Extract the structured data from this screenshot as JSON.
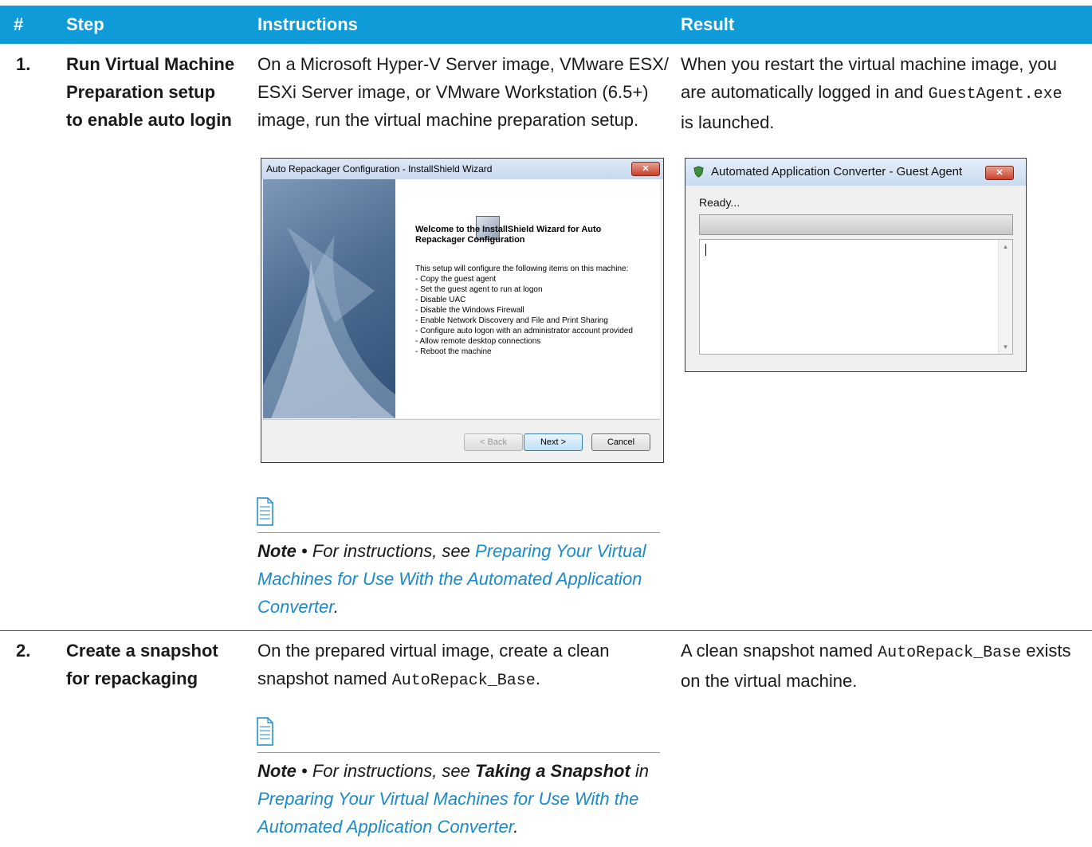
{
  "table": {
    "headers": [
      "#",
      "Step",
      "Instructions",
      "Result"
    ]
  },
  "rows": [
    {
      "num": "1.",
      "step_lines": [
        "Run Virtual Machine",
        "Preparation setup",
        "to enable auto login"
      ],
      "instr_lines": [
        "On a Microsoft Hyper-V Server image, VMware ESX/",
        "ESXi Server image, or VMware Workstation (6.5+)",
        "image, run the virtual machine preparation setup."
      ],
      "result_line1": "When you restart the virtual machine image, you",
      "result_line2": "are automatically logged in and ",
      "result_code": "GuestAgent.exe",
      "result_line3": "is launched.",
      "note_label": "Note",
      "note_sep": " • ",
      "note_text": "For instructions, see ",
      "note_link_lines": [
        "Preparing Your Virtual",
        "Machines for Use With the Automated Application",
        "Converter"
      ],
      "note_end": "."
    },
    {
      "num": "2.",
      "step_lines": [
        "Create a snapshot",
        "for repackaging"
      ],
      "instr_line1": "On the prepared virtual image, create a clean",
      "instr_line2_pre": "snapshot named ",
      "instr_code": "AutoRepack_Base",
      "instr_end": ".",
      "result_pre": "A clean snapshot named ",
      "result_code": "AutoRepack_Base",
      "result_post": " exists",
      "result_line2": "on the virtual machine.",
      "note_label": "Note",
      "note_sep": " • ",
      "note_text": "For instructions, see ",
      "note_bold": "Taking a Snapshot",
      "note_in": " in",
      "note_link_lines": [
        "Preparing Your Virtual Machines for Use With the",
        "Automated Application Converter"
      ],
      "note_end": "."
    }
  ],
  "wizard": {
    "title": "Auto Repackager Configuration - InstallShield Wizard",
    "heading": "Welcome to the InstallShield Wizard for Auto Repackager Configuration",
    "body": "This setup will configure the following items on this machine:\n- Copy the guest agent\n- Set the guest agent to run at logon\n- Disable UAC\n- Disable the Windows Firewall\n- Enable Network Discovery and File and Print Sharing\n- Configure auto logon with an administrator account provided\n- Allow remote desktop connections\n- Reboot the machine",
    "back": "< Back",
    "next": "Next >",
    "cancel": "Cancel",
    "close": "✕"
  },
  "guest_agent": {
    "title": "Automated Application Converter - Guest Agent",
    "status": "Ready...",
    "close": "✕",
    "progress": 0
  },
  "colors": {
    "header": "#0f9bd7",
    "link": "#1a8ac9"
  }
}
